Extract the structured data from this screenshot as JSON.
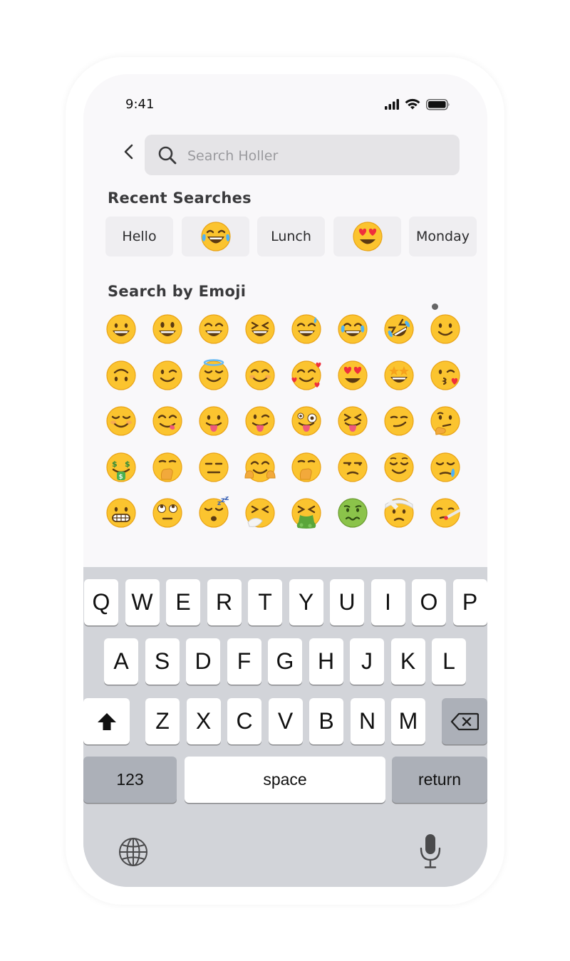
{
  "status": {
    "time": "9:41"
  },
  "search": {
    "placeholder": "Search Holler",
    "value": ""
  },
  "recent": {
    "title": "Recent Searches",
    "items": [
      {
        "type": "text",
        "label": "Hello"
      },
      {
        "type": "emoji",
        "name": "face-with-tears-of-joy"
      },
      {
        "type": "text",
        "label": "Lunch"
      },
      {
        "type": "emoji",
        "name": "heart-eyes"
      },
      {
        "type": "text",
        "label": "Monday"
      }
    ]
  },
  "emoji_section": {
    "title": "Search by Emoji",
    "emojis": [
      "grinning-face",
      "grinning-face-big-eyes",
      "grinning-face-smiling-eyes",
      "grinning-squinting-face",
      "grinning-face-with-sweat",
      "face-with-tears-of-joy",
      "rolling-on-floor-laughing",
      "slightly-smiling-face",
      "upside-down-face",
      "winking-face",
      "smiling-face-with-halo",
      "smiling-face-with-smiling-eyes",
      "smiling-face-with-hearts",
      "heart-eyes",
      "star-struck",
      "face-blowing-kiss",
      "smiling-face",
      "face-savoring-food",
      "face-with-tongue",
      "winking-face-with-tongue",
      "zany-face",
      "squinting-face-with-tongue",
      "smirking-face",
      "thinking-face",
      "money-mouth-face",
      "hand-over-mouth",
      "expressionless-face",
      "hugging-face",
      "hand-over-mouth",
      "unamused-face",
      "relieved-face",
      "sleepy-face",
      "grimacing-face",
      "face-with-rolling-eyes",
      "sleeping-face",
      "sneezing-face",
      "face-vomiting",
      "nauseated-face",
      "face-with-head-bandage",
      "face-with-thermometer"
    ]
  },
  "keyboard": {
    "row1": [
      "Q",
      "W",
      "E",
      "R",
      "T",
      "Y",
      "U",
      "I",
      "O",
      "P"
    ],
    "row2": [
      "A",
      "S",
      "D",
      "F",
      "G",
      "H",
      "J",
      "K",
      "L"
    ],
    "row3": [
      "Z",
      "X",
      "C",
      "V",
      "B",
      "N",
      "M"
    ],
    "numbers_label": "123",
    "space_label": "space",
    "return_label": "return",
    "shift_icon": "shift-icon",
    "delete_icon": "delete-icon",
    "globe_icon": "globe-icon",
    "mic_icon": "microphone-icon"
  },
  "colors": {
    "emoji_yellow": "#fbc42f",
    "emoji_outline": "#e9a317",
    "key_bg": "#ffffff",
    "keyboard_bg": "#d2d4d9",
    "function_key_bg": "#acb0b8"
  }
}
